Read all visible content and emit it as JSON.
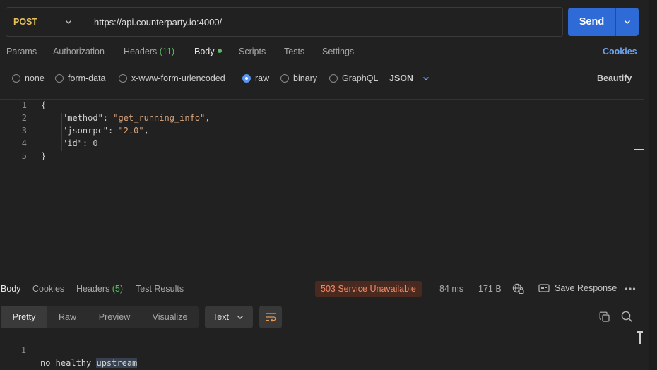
{
  "request": {
    "method": "POST",
    "url": "https://api.counterparty.io:4000/",
    "send_label": "Send"
  },
  "tabs": {
    "params": "Params",
    "authorization": "Authorization",
    "headers": "Headers",
    "headers_count": "(11)",
    "body": "Body",
    "scripts": "Scripts",
    "tests": "Tests",
    "settings": "Settings",
    "cookies": "Cookies"
  },
  "body_types": {
    "none": "none",
    "form_data": "form-data",
    "urlencoded": "x-www-form-urlencoded",
    "raw": "raw",
    "binary": "binary",
    "graphql": "GraphQL",
    "language": "JSON",
    "beautify": "Beautify",
    "selected": "raw"
  },
  "editor": {
    "lines": [
      {
        "n": "1",
        "text": "{"
      },
      {
        "n": "2",
        "key": "\"method\"",
        "sep": ": ",
        "val": "\"get_running_info\"",
        "end": ","
      },
      {
        "n": "3",
        "key": "\"jsonrpc\"",
        "sep": ": ",
        "val": "\"2.0\"",
        "end": ","
      },
      {
        "n": "4",
        "key": "\"id\"",
        "sep": ": ",
        "num": "0"
      },
      {
        "n": "5",
        "text": "}"
      }
    ]
  },
  "response": {
    "tabs": {
      "body": "Body",
      "cookies": "Cookies",
      "headers": "Headers",
      "headers_count": "(5)",
      "test_results": "Test Results"
    },
    "status": "503 Service Unavailable",
    "time": "84 ms",
    "size": "171 B",
    "save_label": "Save Response",
    "views": [
      "Pretty",
      "Raw",
      "Preview",
      "Visualize"
    ],
    "selected_view": "Pretty",
    "format": "Text",
    "line_no": "1",
    "body_text_a": "no healthy ",
    "body_text_b": "upstream"
  },
  "colors": {
    "accent": "#2f6bd6",
    "method": "#e6c15a",
    "success_dot": "#5fb860",
    "error_bg": "#4a2a1f",
    "error_text": "#ef8a6a",
    "link": "#6ea4ef"
  },
  "icons": {
    "method_dropdown": "chevron-down-icon",
    "send_dropdown": "chevron-down-icon",
    "language_dropdown": "chevron-down-icon",
    "network": "globe-lock-icon",
    "save": "save-icon",
    "more": "more-horizontal-icon",
    "wrap": "wrap-lines-icon",
    "copy": "copy-icon",
    "search": "search-icon"
  }
}
